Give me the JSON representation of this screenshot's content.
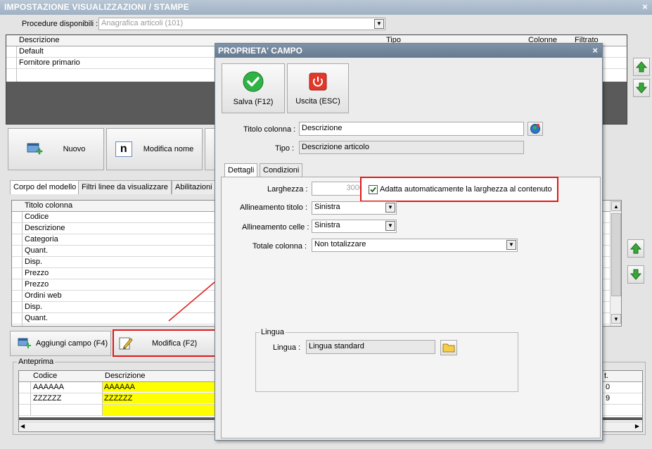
{
  "window": {
    "title": "IMPOSTAZIONE VISUALIZZAZIONI / STAMPE",
    "close": "×"
  },
  "procedure": {
    "label": "Procedure disponibili :",
    "value": "Anagrafica articoli (101)"
  },
  "models_grid": {
    "headers": [
      "Descrizione",
      "Tipo",
      "Colonne",
      "Filtrato"
    ],
    "rows": [
      "Default",
      "Fornitore primario"
    ]
  },
  "model_buttons": {
    "new": "Nuovo",
    "rename": "Modifica nome",
    "rename_glyph": "n"
  },
  "main_tabs": [
    "Corpo del modello",
    "Filtri linee da visualizzare",
    "Abilitazioni"
  ],
  "columns_grid": {
    "header": "Titolo colonna",
    "rows": [
      "Codice",
      "Descrizione",
      "Categoria",
      "Quant.",
      "Disp.",
      "Prezzo",
      "Prezzo",
      "Ordini web",
      "Disp.",
      "Quant."
    ]
  },
  "field_buttons": {
    "add": "Aggiungi campo (F4)",
    "edit": "Modifica (F2)"
  },
  "preview": {
    "group": "Anteprima",
    "headers": [
      "Codice",
      "Descrizione",
      "t."
    ],
    "rows": [
      {
        "code": "AAAAAA",
        "desc": "AAAAAA",
        "tail": "0"
      },
      {
        "code": "ZZZZZZ",
        "desc": "ZZZZZZ",
        "tail": "9"
      }
    ]
  },
  "dialog": {
    "title": "PROPRIETA' CAMPO",
    "close": "×",
    "save": "Salva (F12)",
    "exit": "Uscita (ESC)",
    "title_label": "Titolo colonna :",
    "title_value": "Descrizione",
    "type_label": "Tipo :",
    "type_value": "Descrizione articolo",
    "tabs": [
      "Dettagli",
      "Condizioni"
    ],
    "width_label": "Larghezza :",
    "width_value": "3000",
    "autowidth_label": "Adatta automaticamente la larghezza al contenuto",
    "autowidth_checked": true,
    "title_align_label": "Allineamento titolo :",
    "title_align_value": "Sinistra",
    "cell_align_label": "Allineamento celle :",
    "cell_align_value": "Sinistra",
    "total_label": "Totale colonna :",
    "total_value": "Non totalizzare",
    "lang_group": "Lingua",
    "lang_label": "Lingua :",
    "lang_value": "Lingua standard"
  },
  "colors": {
    "highlight_red": "#e01818",
    "preview_yellow": "#ffff00",
    "check_green": "#2fb344",
    "exit_red": "#e0382a"
  }
}
